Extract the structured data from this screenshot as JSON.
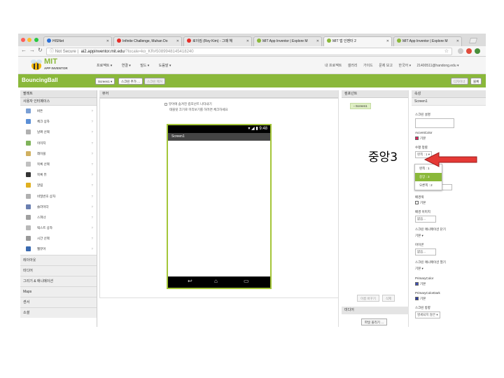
{
  "browser": {
    "tabs": [
      {
        "label": "HISNet",
        "color": "#2a6fd6",
        "active": false
      },
      {
        "label": "Infinite Challenge, Muhan Do",
        "color": "#e52d27",
        "active": false
      },
      {
        "label": "로이킴 (Roy Kim) - 그때 헤",
        "color": "#e52d27",
        "active": false
      },
      {
        "label": "MIT App Inventor | Explore M",
        "color": "#8ab83a",
        "active": false
      },
      {
        "label": "MIT 앱 인벤터 2",
        "color": "#8ab83a",
        "active": true
      },
      {
        "label": "MIT App Inventor | Explore M",
        "color": "#8ab83a",
        "active": false
      }
    ],
    "not_secure": "Not Secure",
    "url_host": "ai2.appinventor.mit.edu",
    "url_path": "/?locale=ko_KR#5089948145418240"
  },
  "app": {
    "logo_main": "MIT",
    "logo_sub": "APP INVENTOR",
    "menu": [
      "프로젝트 ▾",
      "연결 ▾",
      "빌드 ▾",
      "도움말 ▾"
    ],
    "right_menu": [
      "내 프로젝트",
      "갤러리",
      "가이드",
      "문제 보고",
      "한국어 ▾",
      "21400511@handong.edu ▾"
    ]
  },
  "project": {
    "name": "BouncingBall",
    "screen_select": "Screen1 ▾",
    "add_screen": "스크린 추가 ...",
    "remove_screen": "스크린 제거",
    "designer": "디자이너",
    "blocks": "블록"
  },
  "palette": {
    "header": "팔레트",
    "section": "사용자 인터페이스",
    "items": [
      {
        "label": "버튼",
        "color": "#7a9fd4"
      },
      {
        "label": "체크 상자",
        "color": "#5b8fd6"
      },
      {
        "label": "날짜 선택",
        "color": "#b0b0b0"
      },
      {
        "label": "이미지",
        "color": "#7fb35a"
      },
      {
        "label": "레이블",
        "color": "#d0b060"
      },
      {
        "label": "목록 선택",
        "color": "#c0c0c0"
      },
      {
        "label": "목록 뷰",
        "color": "#333333"
      },
      {
        "label": "알림",
        "color": "#e0b020"
      },
      {
        "label": "비밀번호 상자",
        "color": "#b0b0b0"
      },
      {
        "label": "슬라이더",
        "color": "#6a7fb0"
      },
      {
        "label": "스피너",
        "color": "#a0a0a0"
      },
      {
        "label": "텍스트 상자",
        "color": "#b8b8b8"
      },
      {
        "label": "시간 선택",
        "color": "#999999"
      },
      {
        "label": "웹뷰어",
        "color": "#3a6ab0"
      }
    ],
    "categories": [
      "레이아웃",
      "미디어",
      "그리기 & 애니메이션",
      "Maps",
      "센서",
      "소셜"
    ]
  },
  "viewer": {
    "header": "뷰어",
    "check1": "뷰어에 숨겨진 컴포넌트 나타내기",
    "check2": "태블릿 크기로 미리보기를 하려면 체크하세요",
    "status_time": "9:48",
    "screen_title": "Screen1"
  },
  "components": {
    "header": "컴포넌트",
    "tree_root": "Screen1",
    "rename": "이름 바꾸기",
    "delete": "삭제",
    "media_header": "미디어",
    "upload": "파일 올리기 ..."
  },
  "properties": {
    "header": "속성",
    "component": "Screen1",
    "about_label": "스크린 설명",
    "accent_label": "AccentColor",
    "accent_value": "기본",
    "accent_color": "#e0245e",
    "align_label": "수평 정렬",
    "align_value": "왼쪽 : 1 ▾",
    "align_options": [
      "왼쪽 : 1",
      "중앙 : 3",
      "오른쪽 : 2"
    ],
    "bg_label": "배경색",
    "bg_value": "기본",
    "bgimg_label": "배경 이미지",
    "bgimg_value": "없음...",
    "close_anim_label": "스크린 애니메이션 닫기",
    "close_anim_value": "기본 ▾",
    "icon_label": "아이콘",
    "icon_value": "없음...",
    "open_anim_label": "스크린 애니메이션 열기",
    "open_anim_value": "기본 ▾",
    "primary_label": "PrimaryColor",
    "primary_value": "기본",
    "primary_color": "#3f51b5",
    "primary_dark_label": "PrimaryColorDark",
    "primary_dark_value": "기본",
    "primary_dark_color": "#303f9f",
    "orientation_label": "스크린 방향",
    "orientation_value": "명세되지 않은 ▾"
  },
  "annotation": {
    "text": "중앙3",
    "arrow_color": "#e53935"
  }
}
